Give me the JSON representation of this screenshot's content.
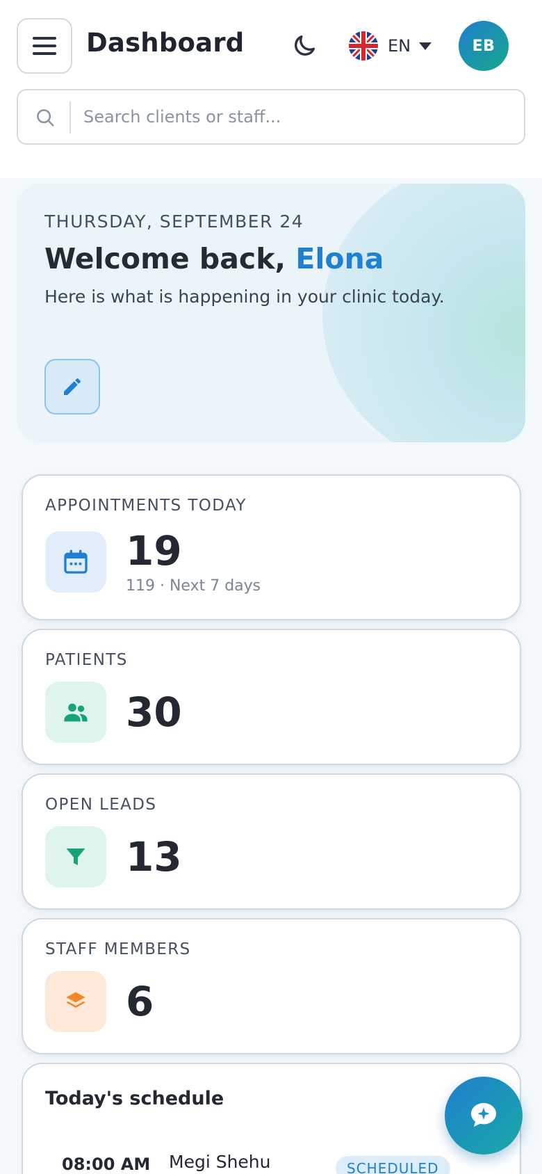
{
  "header": {
    "title": "Dashboard",
    "language": "EN",
    "avatar_initials": "EB",
    "menu_icon": "hamburger-menu-icon",
    "theme_icon": "moon-icon",
    "flag_icon": "uk-flag-icon"
  },
  "search": {
    "placeholder": "Search clients or staff..."
  },
  "welcome": {
    "date": "THURSDAY, SEPTEMBER 24",
    "greeting_prefix": "Welcome back, ",
    "user_name": "Elona",
    "subtitle": "Here is what is happening in your clinic today."
  },
  "stats": [
    {
      "label": "APPOINTMENTS TODAY",
      "value": "19",
      "note": "119 · Next 7 days",
      "icon": "calendar-icon",
      "color": "#1f7fd0"
    },
    {
      "label": "PATIENTS",
      "value": "30",
      "note": "",
      "icon": "users-icon",
      "color": "#16a37a"
    },
    {
      "label": "OPEN LEADS",
      "value": "13",
      "note": "",
      "icon": "filter-icon",
      "color": "#16a37a"
    },
    {
      "label": "STAFF MEMBERS",
      "value": "6",
      "note": "",
      "icon": "layers-icon",
      "color": "#f0872a"
    }
  ],
  "schedule": {
    "title": "Today's schedule",
    "items": [
      {
        "time": "08:00 AM",
        "patient": "Megi Shehu",
        "status": "SCHEDULED"
      }
    ]
  },
  "colors": {
    "accent": "#1f7fd0",
    "teal": "#17a88b"
  }
}
